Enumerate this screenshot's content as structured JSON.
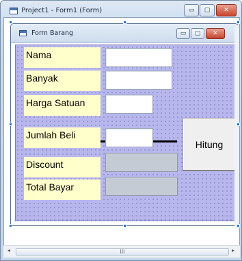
{
  "designer": {
    "title": "Project1 - Form1 (Form)",
    "minimize_glyph": "▭",
    "maximize_glyph": "▢",
    "close_glyph": "✕"
  },
  "form": {
    "title": "Form Barang",
    "minimize_glyph": "▭",
    "maximize_glyph": "▢",
    "close_glyph": "✕",
    "labels": {
      "nama": "Nama",
      "banyak": "Banyak",
      "harga_satuan": "Harga Satuan",
      "jumlah_beli": "Jumlah Beli",
      "discount": "Discount",
      "total_bayar": "Total Bayar"
    },
    "fields": {
      "nama": "",
      "banyak": "",
      "harga_satuan": "",
      "jumlah_beli": "",
      "discount": "",
      "total_bayar": ""
    },
    "button_label": "Hitung"
  },
  "hscroll": {
    "left_arrow": "◂",
    "right_arrow": "▸",
    "grip": "III"
  },
  "colors": {
    "label_background": "#ffffcc",
    "form_background": "#b7b7ee",
    "selection_handle": "#1a74d8"
  }
}
